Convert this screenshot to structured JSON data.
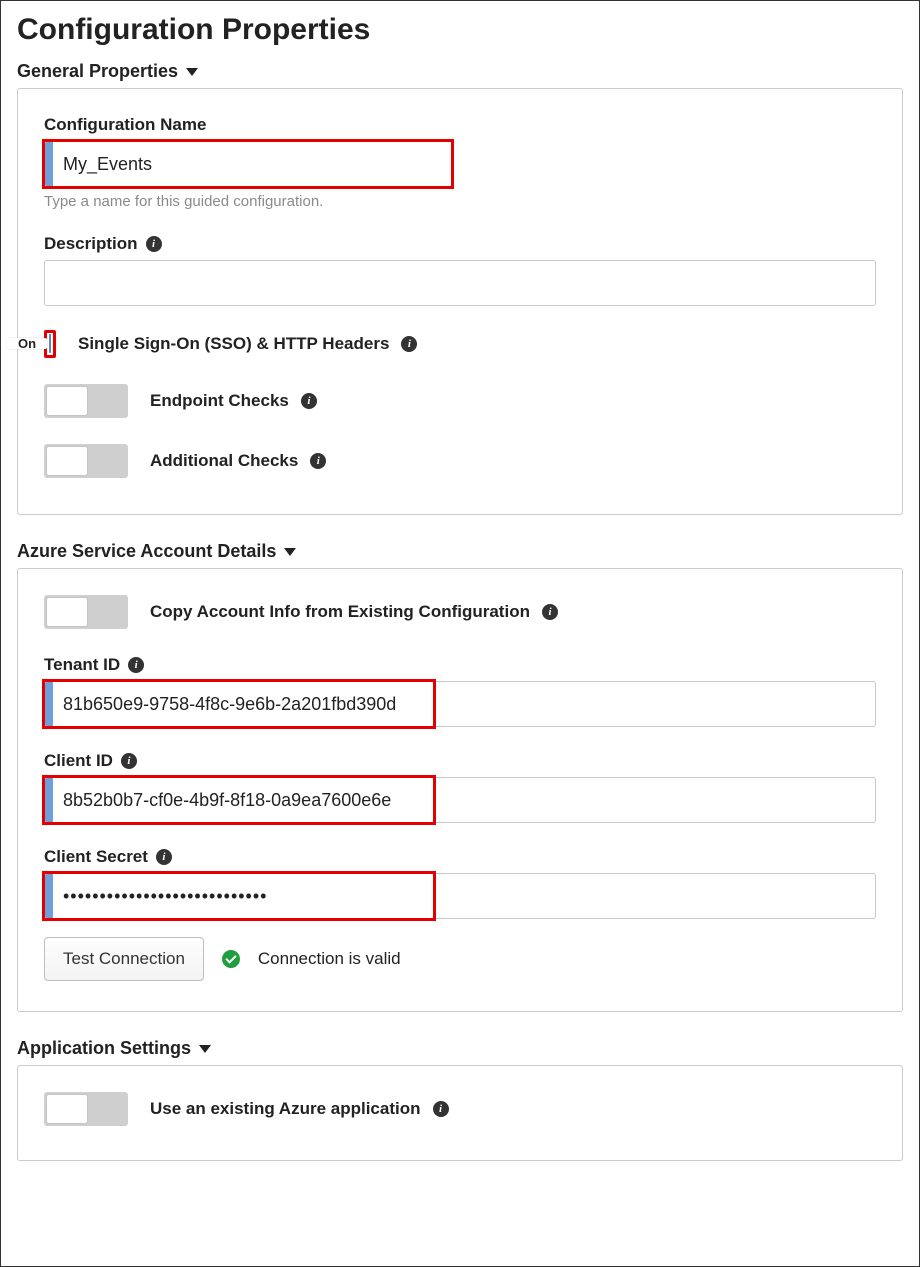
{
  "page_title": "Configuration Properties",
  "sections": {
    "general": {
      "header": "General Properties",
      "config_name": {
        "label": "Configuration Name",
        "value": "My_Events",
        "help": "Type a name for this guided configuration."
      },
      "description": {
        "label": "Description",
        "value": ""
      },
      "toggles": {
        "sso": {
          "label": "Single Sign-On (SSO) & HTTP Headers",
          "on_text": "On",
          "state": "on"
        },
        "endpoint": {
          "label": "Endpoint Checks",
          "state": "off"
        },
        "additional": {
          "label": "Additional Checks",
          "state": "off"
        }
      }
    },
    "azure": {
      "header": "Azure Service Account Details",
      "copy_toggle": {
        "label": "Copy Account Info from Existing Configuration",
        "state": "off"
      },
      "tenant_id": {
        "label": "Tenant ID",
        "value": "81b650e9-9758-4f8c-9e6b-2a201fbd390d"
      },
      "client_id": {
        "label": "Client ID",
        "value": "8b52b0b7-cf0e-4b9f-8f18-0a9ea7600e6e"
      },
      "client_secret": {
        "label": "Client Secret",
        "value": "••••••••••••••••••••••••••••"
      },
      "test_button": "Test Connection",
      "status_text": "Connection is valid"
    },
    "app_settings": {
      "header": "Application Settings",
      "use_existing": {
        "label": "Use an existing Azure application",
        "state": "off"
      }
    }
  }
}
